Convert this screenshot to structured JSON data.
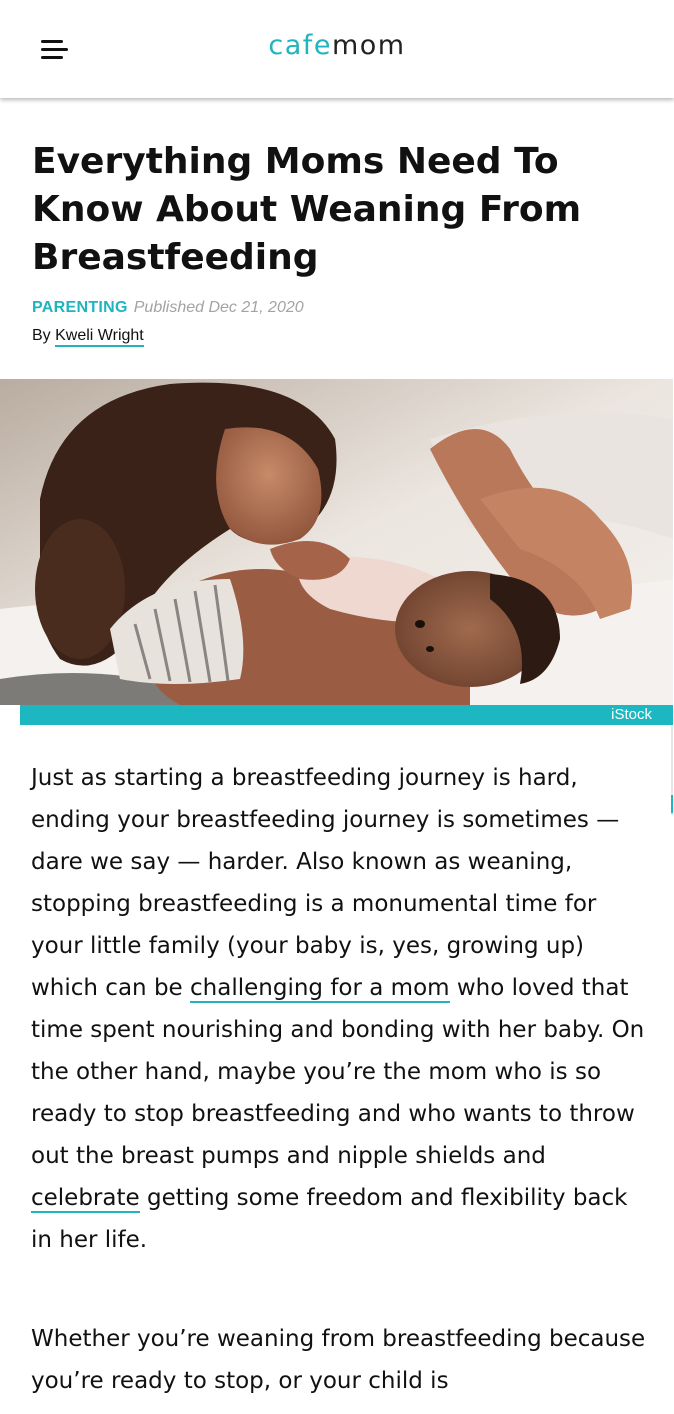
{
  "header": {
    "logo_cafe": "cafe",
    "logo_mom": "mom"
  },
  "article": {
    "title": "Everything Moms Need To Know About Weaning From Breastfeeding",
    "category": "PARENTING",
    "published": "Published Dec 21, 2020",
    "by_prefix": "By ",
    "author": "Kweli Wright",
    "image_credit": "iStock",
    "paragraph1": {
      "text1": "Just as starting a breastfeeding journey is hard, ending your breastfeeding journey is sometimes — dare we say — harder. Also known as weaning, stopping breastfeeding is a monumental time for your little family (your baby is, yes, growing up) which can be ",
      "link1": "challenging for a mom",
      "text2": " who loved that time spent nourishing and bonding with her baby. On the other hand, maybe you’re the mom who is so ready to stop breastfeeding and who wants to throw out the breast pumps and nipple shields and ",
      "link2": "celebrate",
      "text3": " getting some freedom and flexibility back in her life."
    },
    "paragraph2": {
      "text": "Whether you’re weaning from breastfeeding because you’re ready to stop, or your child is"
    }
  },
  "colors": {
    "accent": "#1fb4bf",
    "credit_bar": "#1cb7c1",
    "published_gray": "#a3a3a3"
  }
}
